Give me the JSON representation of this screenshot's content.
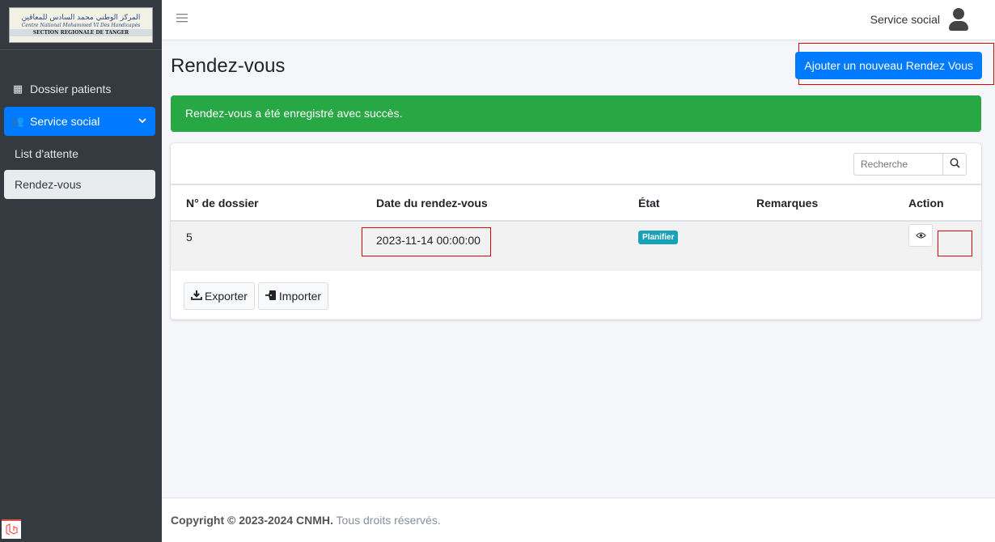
{
  "logo": {
    "arabic": "المركز الوطني محمد السادس للمعاقين",
    "french": "Centre National Mohammed VI Des Handicapés",
    "section": "SECTION REGIONALE DE TANGER"
  },
  "sidebar": {
    "items": [
      {
        "label": "Dossier patients",
        "icon": "hospital-user-icon"
      },
      {
        "label": "Service social",
        "icon": "users-icon",
        "active": true
      }
    ],
    "sub_items": [
      {
        "label": "List d'attente"
      },
      {
        "label": "Rendez-vous",
        "current": true
      }
    ]
  },
  "topbar": {
    "user_label": "Service social"
  },
  "page": {
    "title": "Rendez-vous",
    "add_button": "Ajouter un nouveau Rendez Vous"
  },
  "alert": {
    "message": "Rendez-vous a été enregistré avec succès."
  },
  "search": {
    "placeholder": "Recherche"
  },
  "table": {
    "headers": [
      "N° de dossier",
      "Date du rendez-vous",
      "État",
      "Remarques",
      "Action"
    ],
    "rows": [
      {
        "dossier": "5",
        "date": "2023-11-14 00:00:00",
        "etat": "Planifier",
        "remarques": ""
      }
    ]
  },
  "toolbar": {
    "export_label": "Exporter",
    "import_label": "Importer"
  },
  "footer": {
    "copyright": "Copyright © 2023-2024 CNMH.",
    "rights": " Tous droits réservés."
  },
  "colors": {
    "primary": "#007bff",
    "success": "#28a745",
    "info": "#17a2b8",
    "sidebar": "#343a40",
    "highlight": "#e00000"
  }
}
